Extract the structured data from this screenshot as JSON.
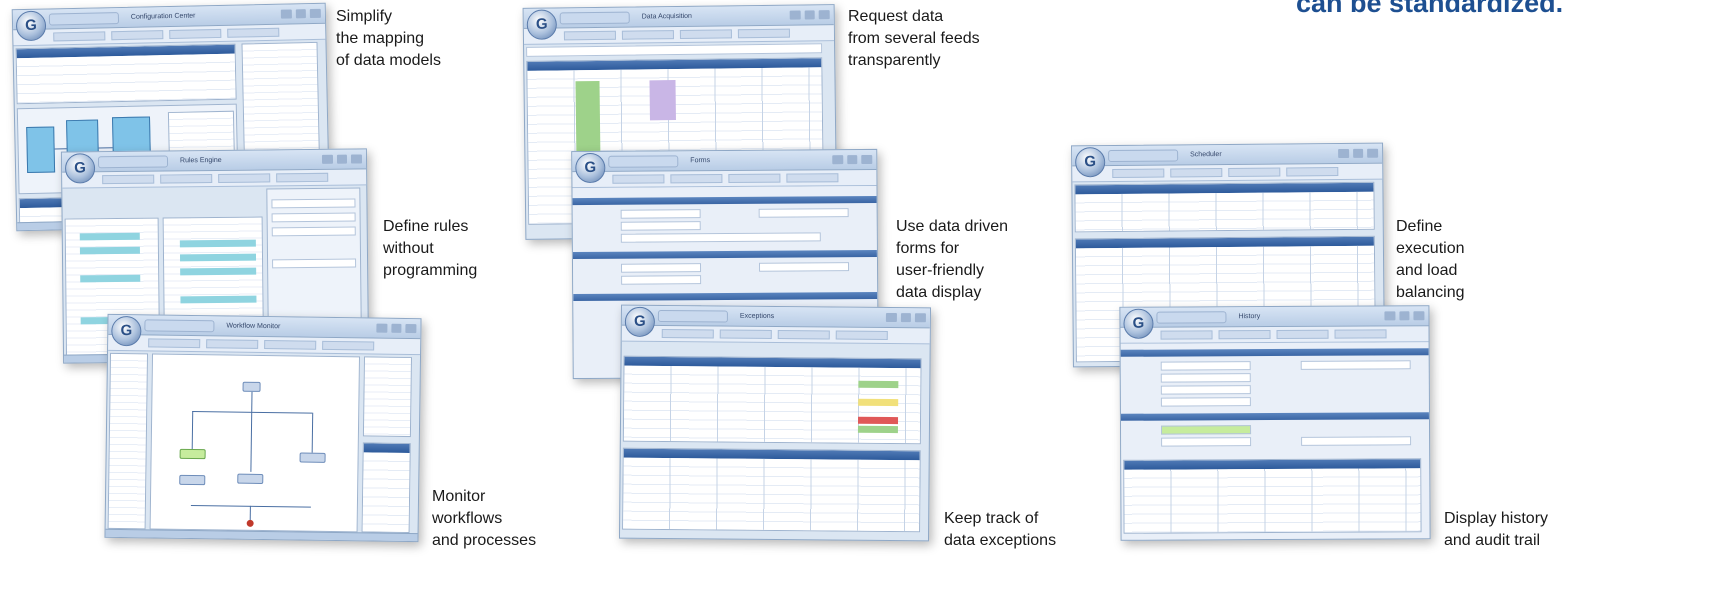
{
  "headline": "can be standardized.",
  "app": {
    "logo_letter": "G",
    "window_titles": [
      "Configuration Center",
      "Data Acquisition",
      "Rules Engine",
      "Forms",
      "Workflow Monitor",
      "Exceptions",
      "Scheduler",
      "History"
    ]
  },
  "captions": [
    {
      "id": "mapping",
      "text": "Simplify\nthe mapping\nof data models"
    },
    {
      "id": "request",
      "text": "Request data\nfrom several feeds\ntransparently"
    },
    {
      "id": "rules",
      "text": "Define rules\nwithout\nprogramming"
    },
    {
      "id": "forms",
      "text": "Use data driven\nforms for\nuser-friendly\ndata display"
    },
    {
      "id": "balancing",
      "text": "Define\nexecution\nand load\nbalancing"
    },
    {
      "id": "monitor",
      "text": "Monitor\nworkflows\nand processes"
    },
    {
      "id": "exceptions",
      "text": "Keep track of\ndata exceptions"
    },
    {
      "id": "history",
      "text": "Display history\nand audit trail"
    }
  ],
  "colors": {
    "headline": "#1d4f91",
    "window_chrome": "#b9cde6",
    "panel_header": "#2d5a9b",
    "mapping_box": "#7fc3e8",
    "status_green": "#9ed28a",
    "status_red": "#e05858",
    "status_yellow": "#f1e07a",
    "highlight_purple": "#c9b6e6"
  }
}
